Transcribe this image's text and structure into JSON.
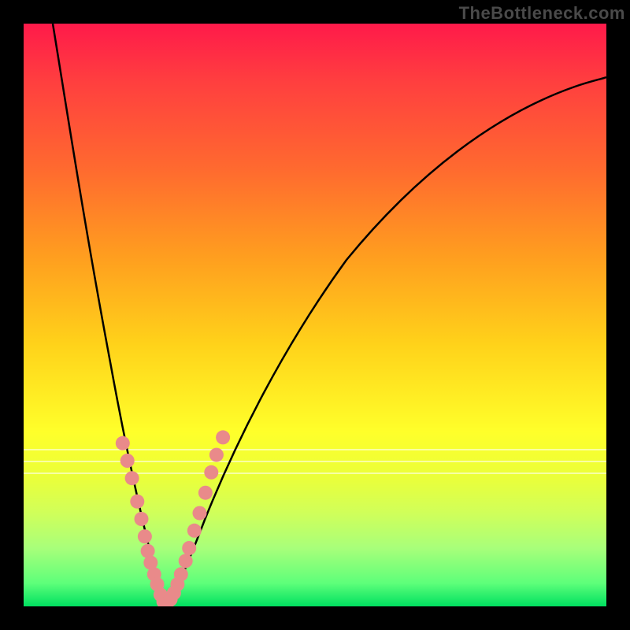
{
  "watermark": "TheBottleneck.com",
  "colors": {
    "dot": "#e98a8a",
    "curve": "#000000",
    "gradient_top": "#ff1a4a",
    "gradient_bottom": "#00e060"
  },
  "chart_data": {
    "type": "line",
    "title": "",
    "xlabel": "",
    "ylabel": "",
    "xlim": [
      0,
      100
    ],
    "ylim": [
      0,
      100
    ],
    "notes": "V-shaped bottleneck curve over red→green vertical gradient; minimum near x≈24. Dots cluster on both arms near the bottom 30%.",
    "series": [
      {
        "name": "left-arm",
        "x": [
          5,
          8,
          11.5,
          15,
          18,
          20.5,
          22.5,
          24
        ],
        "values": [
          100,
          80,
          58,
          38,
          22,
          11,
          4,
          0
        ]
      },
      {
        "name": "right-arm",
        "x": [
          24,
          26,
          29,
          33,
          38,
          45,
          55,
          68,
          82,
          95,
          100
        ],
        "values": [
          0,
          3,
          9,
          18,
          29,
          42,
          56,
          70,
          81,
          88,
          90
        ]
      }
    ],
    "dots": [
      {
        "x": 17.0,
        "y": 28
      },
      {
        "x": 17.8,
        "y": 25
      },
      {
        "x": 18.6,
        "y": 22
      },
      {
        "x": 19.5,
        "y": 18
      },
      {
        "x": 20.2,
        "y": 15
      },
      {
        "x": 20.8,
        "y": 12
      },
      {
        "x": 21.3,
        "y": 9.5
      },
      {
        "x": 21.8,
        "y": 7.5
      },
      {
        "x": 22.4,
        "y": 5.5
      },
      {
        "x": 22.9,
        "y": 3.8
      },
      {
        "x": 23.5,
        "y": 2
      },
      {
        "x": 24.0,
        "y": 0.8
      },
      {
        "x": 24.6,
        "y": 0.5
      },
      {
        "x": 25.2,
        "y": 1.2
      },
      {
        "x": 25.8,
        "y": 2.3
      },
      {
        "x": 26.4,
        "y": 3.8
      },
      {
        "x": 27.0,
        "y": 5.5
      },
      {
        "x": 27.8,
        "y": 7.8
      },
      {
        "x": 28.4,
        "y": 10
      },
      {
        "x": 29.3,
        "y": 13
      },
      {
        "x": 30.2,
        "y": 16
      },
      {
        "x": 31.2,
        "y": 19.5
      },
      {
        "x": 32.2,
        "y": 23
      },
      {
        "x": 33.1,
        "y": 26
      },
      {
        "x": 34.2,
        "y": 29
      }
    ],
    "white_bands_y": [
      73,
      75,
      77
    ]
  }
}
